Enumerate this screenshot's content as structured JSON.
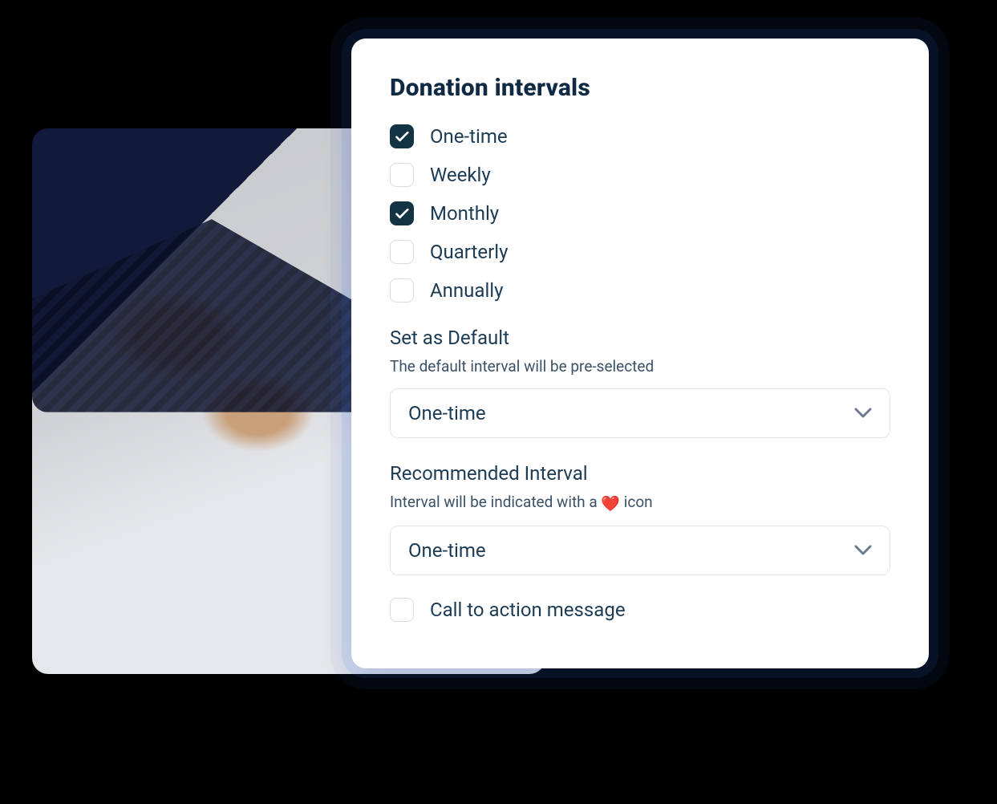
{
  "panel": {
    "title": "Donation intervals",
    "options": [
      {
        "label": "One-time",
        "checked": true
      },
      {
        "label": "Weekly",
        "checked": false
      },
      {
        "label": "Monthly",
        "checked": true
      },
      {
        "label": "Quarterly",
        "checked": false
      },
      {
        "label": "Annually",
        "checked": false
      }
    ],
    "default": {
      "label": "Set as Default",
      "sub": "The default interval will be pre-selected",
      "value": "One-time"
    },
    "recommended": {
      "label": "Recommended Interval",
      "sub_before": "Interval will be indicated with a ",
      "sub_after": " icon",
      "icon": "heart",
      "value": "One-time"
    },
    "cta": {
      "label": "Call to action message",
      "checked": false
    }
  }
}
